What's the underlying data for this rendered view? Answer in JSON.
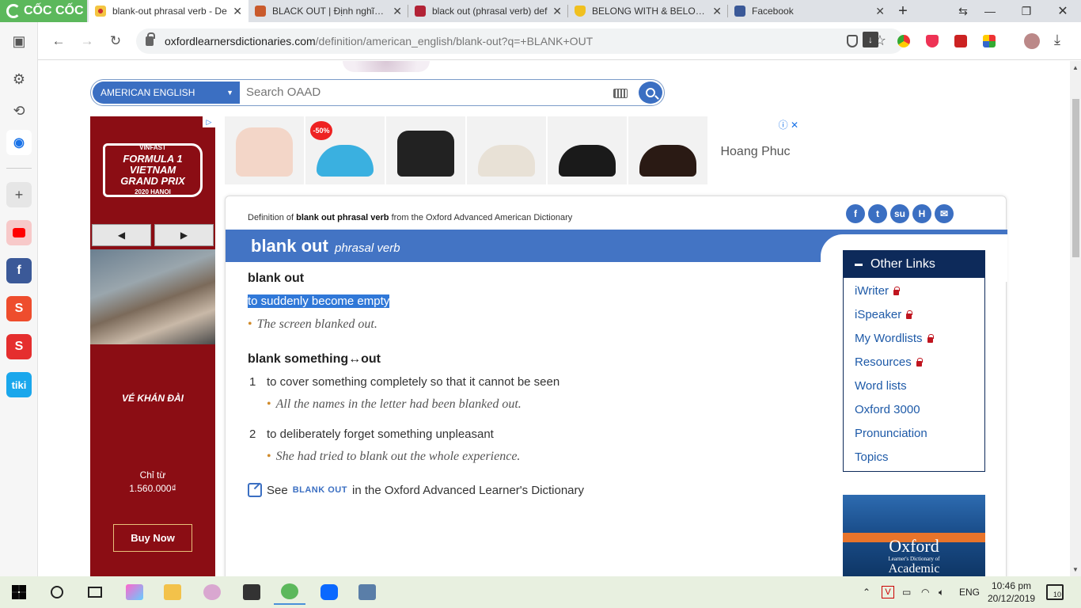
{
  "browser": {
    "brand": "CỐC CỐC",
    "tabs": [
      {
        "title": "blank-out phrasal verb - De",
        "icon": "oxford-icon",
        "active": true
      },
      {
        "title": "BLACK OUT | Định nghĩa tro",
        "icon": "cambridge-icon",
        "active": false
      },
      {
        "title": "black out (phrasal verb) def",
        "icon": "book-icon",
        "active": false
      },
      {
        "title": "BELONG WITH & BELONG T",
        "icon": "shield-icon",
        "active": false
      },
      {
        "title": "Facebook",
        "icon": "facebook-icon",
        "active": false
      }
    ],
    "url_host": "oxfordlearnersdictionaries.com",
    "url_path": "/definition/american_english/blank-out?q=+BLANK+OUT"
  },
  "search": {
    "dictionary": "AMERICAN ENGLISH",
    "placeholder": "Search OAAD"
  },
  "left_ad": {
    "f1_line1": "FORMULA 1",
    "f1_line2": "VINFAST",
    "f1_line3": "VIETNAM",
    "f1_line4": "GRAND PRIX",
    "f1_line5": "2020 HANOI",
    "prev": "◀",
    "next": "▶",
    "tagline": "VÉ KHÁN ĐÀI",
    "price_label": "Chỉ từ",
    "price_value": "1.560.000₫",
    "cta": "Buy Now"
  },
  "top_ad": {
    "discount_badge": "-50%",
    "brand": "Hoang Phuc",
    "info": "ⓘ",
    "close": "✕"
  },
  "entry": {
    "definition_prefix": "Definition of ",
    "definition_term": "blank out phrasal verb",
    "definition_suffix": " from the Oxford Advanced American Dictionary",
    "headword": "blank out",
    "pos": "phrasal verb",
    "senses": [
      {
        "phrase": "blank out",
        "definition": "to suddenly become empty",
        "example": "The screen blanked out."
      },
      {
        "phrase": "blank something↔out"
      }
    ],
    "subsenses": [
      {
        "num": "1",
        "definition": "to cover something completely so that it cannot be seen",
        "example": "All the names in the letter had been blanked out."
      },
      {
        "num": "2",
        "definition": "to deliberately forget something unpleasant",
        "example": "She had tried to blank out the whole experience."
      }
    ],
    "see_prefix": "See",
    "see_link": "BLANK OUT",
    "see_suffix": "in the Oxford Advanced Learner's Dictionary",
    "bullet": "•"
  },
  "other_links": {
    "title": "Other Links",
    "items": [
      "iWriter",
      "iSpeaker",
      "My Wordlists",
      "Resources",
      "Word lists",
      "Oxford 3000",
      "Pronunciation",
      "Topics"
    ],
    "locked": [
      true,
      true,
      true,
      true,
      false,
      false,
      false,
      false
    ]
  },
  "book_ad": {
    "title": "Oxford",
    "subtitle": "Learner's Dictionary of",
    "edition": "Academic"
  },
  "taskbar": {
    "lang": "ENG",
    "time": "10:46 pm",
    "date": "20/12/2019",
    "notifications": "10"
  },
  "colors": {
    "accent_blue": "#4374c4",
    "oxford_navy": "#0d2a5a",
    "ad_red": "#8b0d14",
    "selection": "#3078d8"
  }
}
